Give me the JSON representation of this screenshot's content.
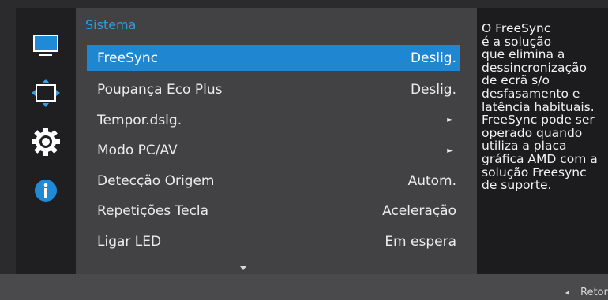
{
  "panel": {
    "title": "Sistema"
  },
  "menu": {
    "items": [
      {
        "label": "FreeSync",
        "value": "Deslig.",
        "selected": true
      },
      {
        "label": "Poupança Eco Plus",
        "value": "Deslig."
      },
      {
        "label": "Tempor.dslg.",
        "value": "►"
      },
      {
        "label": "Modo PC/AV",
        "value": "►"
      },
      {
        "label": "Detecção Origem",
        "value": "Autom."
      },
      {
        "label": "Repetições Tecla",
        "value": "Aceleração"
      },
      {
        "label": "Ligar LED",
        "value": "Em espera"
      }
    ]
  },
  "description": {
    "text": "O FreeSync\né a solução\nque elimina a\ndessincronização\nde ecrã s/o\ndesfasamento e\nlatência habituais.\nFreeSync pode ser\noperado quando\nutiliza a placa\ngráfica AMD com a\nsolução Freesync\nde suporte."
  },
  "footer": {
    "return_label": "Retorno"
  },
  "icons": {
    "sidebar": [
      "monitor-icon",
      "size-position-icon",
      "gear-icon",
      "info-icon"
    ],
    "accent": "#1f86d2",
    "title_color": "#2a9fe0"
  }
}
